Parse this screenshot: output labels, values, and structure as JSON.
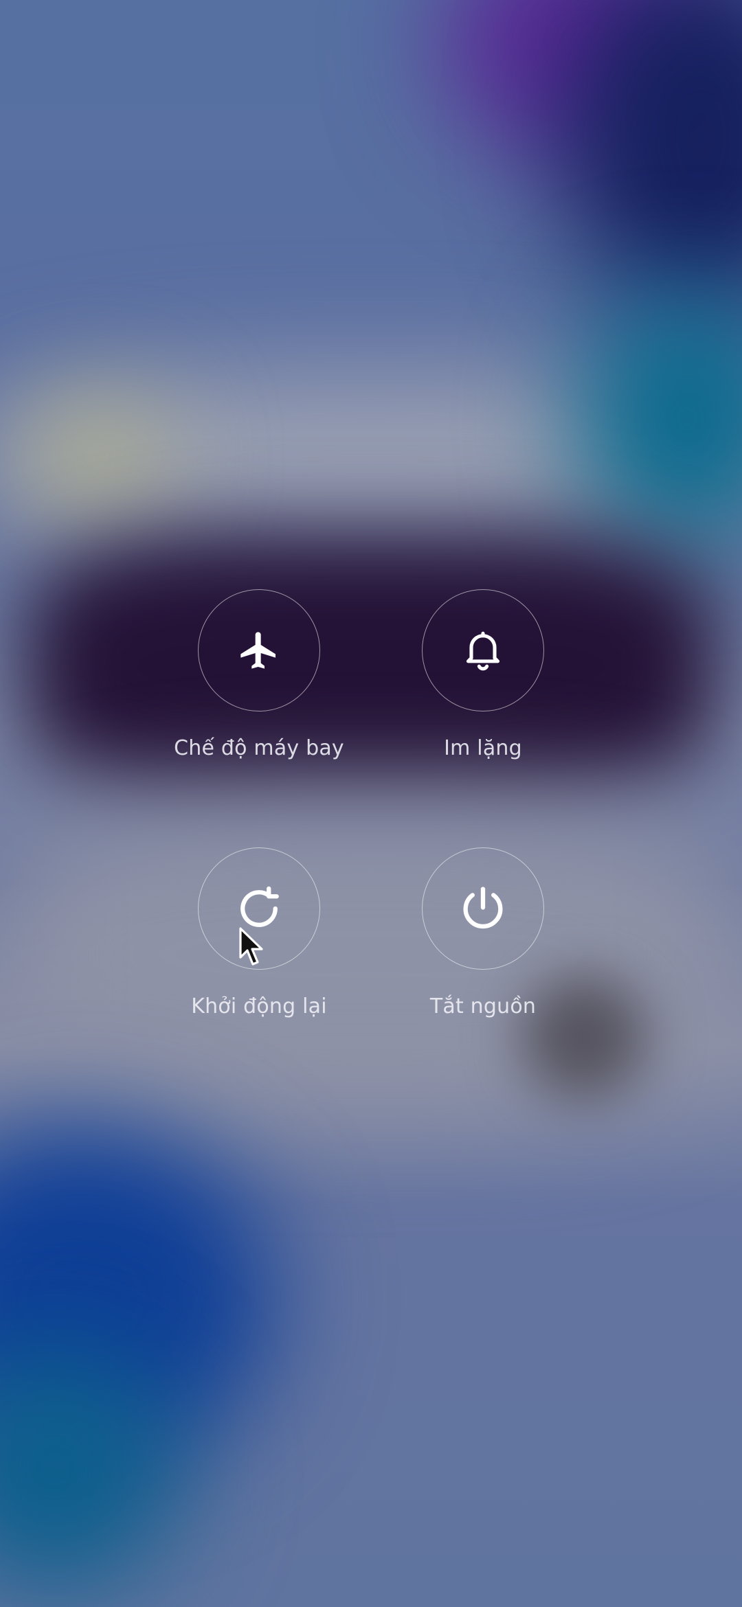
{
  "power_menu": {
    "airplane": {
      "label": "Chế độ máy bay",
      "icon": "airplane-icon"
    },
    "silent": {
      "label": "Im lặng",
      "icon": "bell-icon"
    },
    "restart": {
      "label": "Khởi động lại",
      "icon": "restart-icon"
    },
    "power_off": {
      "label": "Tắt nguồn",
      "icon": "power-icon"
    }
  },
  "colors": {
    "icon": "#ffffff",
    "ring": "#ffffff",
    "label": "#e8e8f0"
  }
}
